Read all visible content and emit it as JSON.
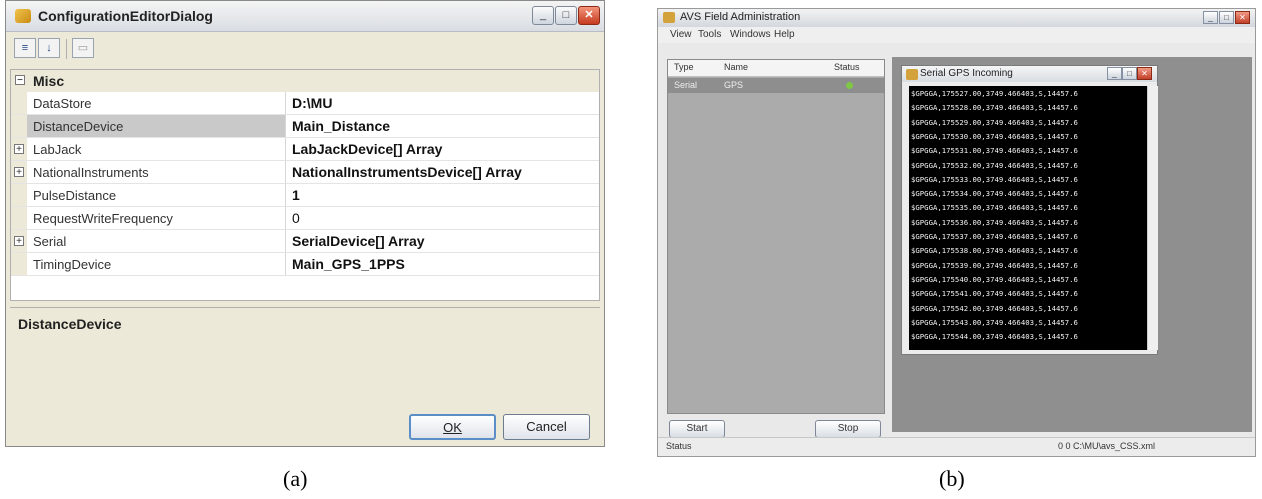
{
  "panel_a": {
    "title": "ConfigurationEditorDialog",
    "toolbar": {
      "categorized_icon": "categorized-icon",
      "alphabetical_icon": "alphabetical-sort-icon",
      "property_pages_icon": "property-pages-icon"
    },
    "category": {
      "expander": "⊟",
      "label": "Misc"
    },
    "properties": [
      {
        "expander": "",
        "name": "DataStore",
        "value": "D:\\MU",
        "bold": true,
        "selected": false
      },
      {
        "expander": "",
        "name": "DistanceDevice",
        "value": "Main_Distance",
        "bold": true,
        "selected": true
      },
      {
        "expander": "+",
        "name": "LabJack",
        "value": "LabJackDevice[] Array",
        "bold": true,
        "selected": false
      },
      {
        "expander": "+",
        "name": "NationalInstruments",
        "value": "NationalInstrumentsDevice[] Array",
        "bold": true,
        "selected": false
      },
      {
        "expander": "",
        "name": "PulseDistance",
        "value": "1",
        "bold": true,
        "selected": false
      },
      {
        "expander": "",
        "name": "RequestWriteFrequency",
        "value": "0",
        "bold": false,
        "selected": false
      },
      {
        "expander": "+",
        "name": "Serial",
        "value": "SerialDevice[] Array",
        "bold": true,
        "selected": false
      },
      {
        "expander": "",
        "name": "TimingDevice",
        "value": "Main_GPS_1PPS",
        "bold": true,
        "selected": false
      }
    ],
    "description_title": "DistanceDevice",
    "ok_label": "OK",
    "cancel_label": "Cancel",
    "caption": "(a)"
  },
  "panel_b": {
    "title": "AVS Field Administration",
    "menu": [
      "View",
      "Tools",
      "Windows",
      "Help"
    ],
    "list_headers": {
      "type": "Type",
      "name": "Name",
      "status": "Status"
    },
    "list_row": {
      "type": "Serial",
      "name": "GPS"
    },
    "status_color": "#7ec845",
    "start_label": "Start",
    "stop_label": "Stop",
    "serial_window_title": "Serial GPS Incoming",
    "terminal_lines": [
      "$GPGGA,175527.00,3749.466403,S,14457.6",
      "$GPGGA,175528.00,3749.466403,S,14457.6",
      "$GPGGA,175529.00,3749.466403,S,14457.6",
      "$GPGGA,175530.00,3749.466403,S,14457.6",
      "$GPGGA,175531.00,3749.466403,S,14457.6",
      "$GPGGA,175532.00,3749.466403,S,14457.6",
      "$GPGGA,175533.00,3749.466403,S,14457.6",
      "$GPGGA,175534.00,3749.466403,S,14457.6",
      "$GPGGA,175535.00,3749.466403,S,14457.6",
      "$GPGGA,175536.00,3749.466403,S,14457.6",
      "$GPGGA,175537.00,3749.466403,S,14457.6",
      "$GPGGA,175538.00,3749.466403,S,14457.6",
      "$GPGGA,175539.00,3749.466403,S,14457.6",
      "$GPGGA,175540.00,3749.466403,S,14457.6",
      "$GPGGA,175541.00,3749.466403,S,14457.6",
      "$GPGGA,175542.00,3749.466403,S,14457.6",
      "$GPGGA,175543.00,3749.466403,S,14457.6",
      "$GPGGA,175544.00,3749.466403,S,14457.6"
    ],
    "status_left": "Status",
    "status_right": "0   0   C:\\MU\\avs_CSS.xml",
    "caption": "(b)"
  }
}
